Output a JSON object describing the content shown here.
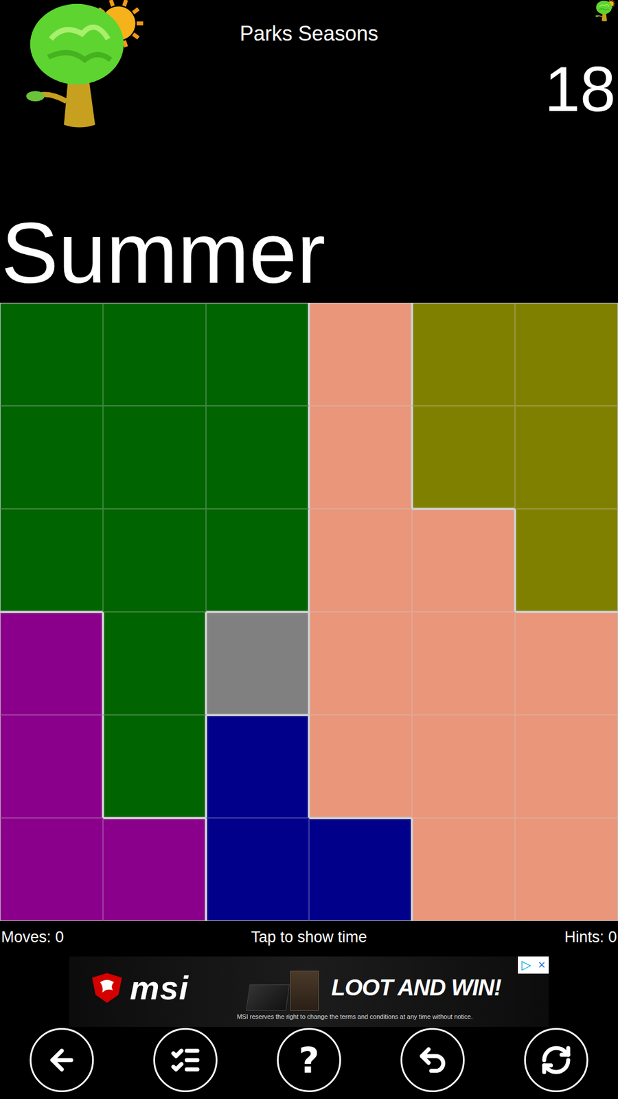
{
  "header": {
    "title": "Parks Seasons",
    "level_number": "18"
  },
  "season": "Summer",
  "board": {
    "regions": [
      {
        "id": "A",
        "color": "#006400"
      },
      {
        "id": "B",
        "color": "#E9967A"
      },
      {
        "id": "C",
        "color": "#808000"
      },
      {
        "id": "D",
        "color": "#8B008B"
      },
      {
        "id": "E",
        "color": "#808080"
      },
      {
        "id": "F",
        "color": "#00008B"
      }
    ],
    "rows": [
      [
        "A",
        "A",
        "A",
        "B",
        "C",
        "C"
      ],
      [
        "A",
        "A",
        "A",
        "B",
        "C",
        "C"
      ],
      [
        "A",
        "A",
        "A",
        "B",
        "B",
        "C"
      ],
      [
        "D",
        "A",
        "E",
        "B",
        "B",
        "B"
      ],
      [
        "D",
        "A",
        "F",
        "B",
        "B",
        "B"
      ],
      [
        "D",
        "D",
        "F",
        "F",
        "B",
        "B"
      ]
    ]
  },
  "status": {
    "moves": "Moves: 0",
    "center": "Tap to show time",
    "hints": "Hints: 0"
  },
  "ad": {
    "brand": "msi",
    "headline": "LOOT AND WIN!",
    "disclaimer": "MSI reserves the right to change the terms and conditions at any time without notice.",
    "choices_icon": "▷",
    "close_icon": "×"
  },
  "toolbar": [
    {
      "kind": "back"
    },
    {
      "kind": "levels"
    },
    {
      "kind": "help",
      "label": "?"
    },
    {
      "kind": "undo"
    },
    {
      "kind": "restart"
    }
  ]
}
